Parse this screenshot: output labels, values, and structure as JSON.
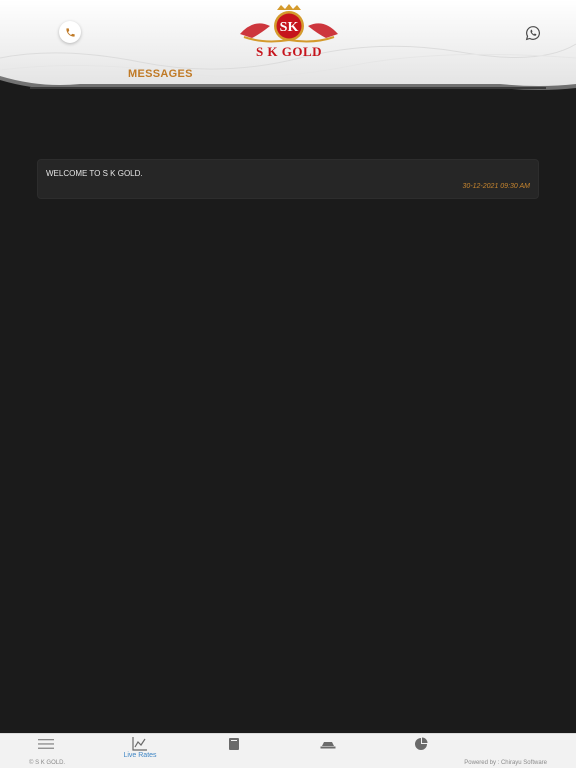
{
  "header": {
    "logo_monogram": "SK",
    "logo_text": "S K GOLD",
    "page_title": "MESSAGES",
    "call_icon": "phone-icon",
    "whatsapp_icon": "whatsapp-icon"
  },
  "messages": [
    {
      "text": "WELCOME TO S K GOLD.",
      "time": "30-12-2021 09:30 AM"
    }
  ],
  "bottom_nav": {
    "items": [
      {
        "icon": "menu-icon",
        "label": "",
        "active": false
      },
      {
        "icon": "chart-icon",
        "label": "Live Rates",
        "active": true
      },
      {
        "icon": "book-icon",
        "label": "",
        "active": false
      },
      {
        "icon": "bank-icon",
        "label": "",
        "active": false
      },
      {
        "icon": "pie-chart-icon",
        "label": "",
        "active": false
      }
    ],
    "copyright": "© S K GOLD.",
    "powered_by": "Powered by : Chirayu Software"
  },
  "colors": {
    "background": "#1b1b1b",
    "accent": "#c07a26",
    "active_nav": "#3f86c5",
    "logo_red": "#c6141c"
  }
}
